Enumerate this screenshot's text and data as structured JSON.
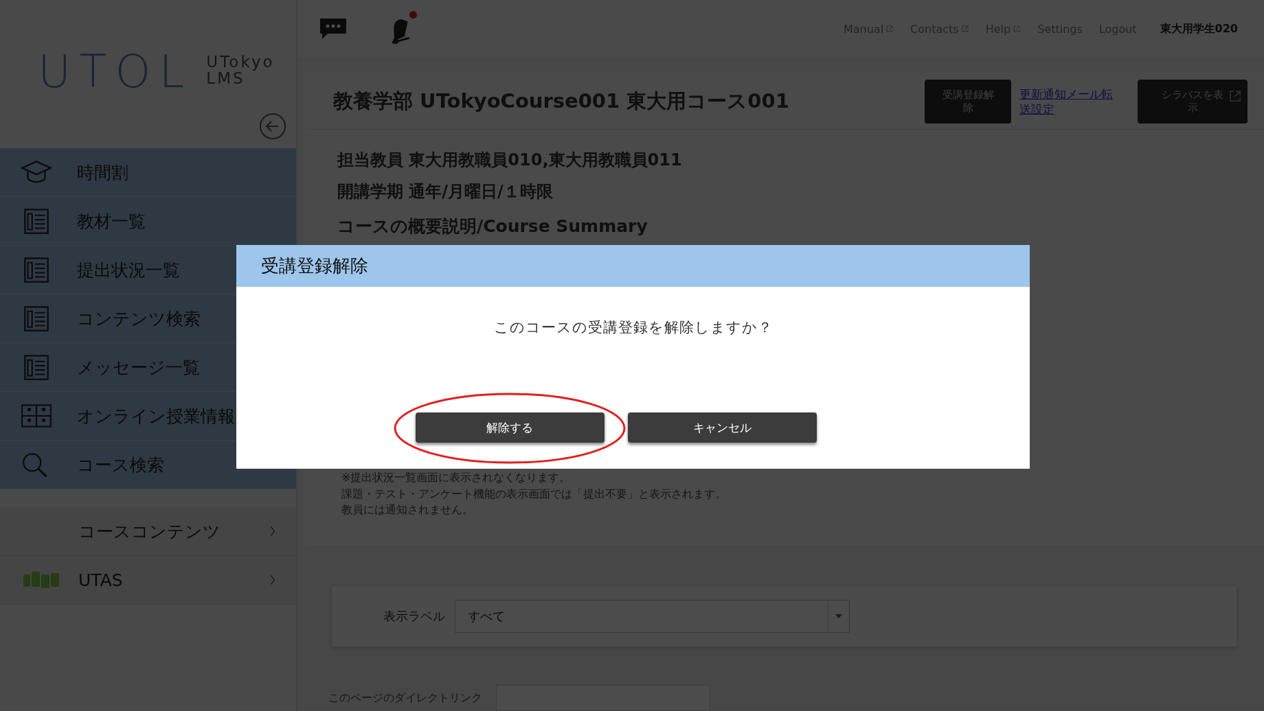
{
  "header": {
    "links": [
      {
        "label": "Manual",
        "external": true
      },
      {
        "label": "Contacts",
        "external": true
      },
      {
        "label": "Help",
        "external": true
      },
      {
        "label": "Settings",
        "external": false
      },
      {
        "label": "Logout",
        "external": false
      }
    ],
    "user": "東大用学生020",
    "notification": true
  },
  "sidebar": {
    "logo": {
      "title": "UTOL",
      "subtitle": [
        "UTokyo",
        "LMS"
      ]
    },
    "menu": [
      {
        "label": "時間割",
        "kind": "timetable"
      },
      {
        "label": "教材一覧",
        "kind": "list"
      },
      {
        "label": "提出状況一覧",
        "kind": "list"
      },
      {
        "label": "コンテンツ検索",
        "kind": "list"
      },
      {
        "label": "メッセージ一覧",
        "kind": "list"
      },
      {
        "label": "オンライン授業情報",
        "kind": "online"
      },
      {
        "label": "コース検索",
        "kind": "search"
      }
    ],
    "sections": [
      {
        "label": "コースコンテンツ",
        "kind": "plain"
      },
      {
        "label": "UTAS",
        "kind": "external"
      }
    ]
  },
  "course": {
    "title": "教養学部 UTokyoCourse001 東大用コース001",
    "unenroll_button": "受講登録解除",
    "mail_link": "更新通知メール転送設定",
    "syllabus_button": "シラバスを表示",
    "info": [
      "担当教員 東大用教職員010,東大用教職員011",
      "開講学期 通年/月曜日/１時限"
    ],
    "summary_heading": "コースの概要説明/Course Summary",
    "notes": [
      "※提出状況一覧画面に表示されなくなります。",
      "課題・テスト・アンケート機能の表示画面では「提出不要」と表示されます。",
      "教員には通知されません。"
    ],
    "filter": {
      "label": "表示ラベル",
      "value": "すべて"
    },
    "direct_link_label": "このページのダイレクトリンク"
  },
  "modal": {
    "title": "受講登録解除",
    "message": "このコースの受講登録を解除しますか？",
    "buttons": [
      {
        "label": "解除する",
        "highlighted": true
      },
      {
        "label": "キャンセル",
        "highlighted": false
      }
    ]
  }
}
